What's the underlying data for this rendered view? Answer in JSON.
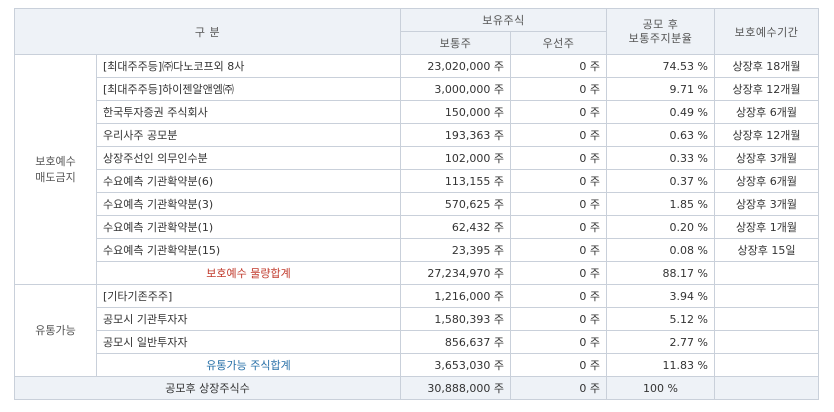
{
  "header": {
    "gubun": "구   분",
    "holdings": "보유주식",
    "common": "보통주",
    "preferred": "우선주",
    "ratio": "공모 후\n보통주지분율",
    "period": "보호예수기간"
  },
  "lockup_group": {
    "label": "보호예수\n매도금지",
    "rows": [
      {
        "name": "[최대주주등]㈜다노코프외 8사",
        "common": "23,020,000 주",
        "preferred": "0 주",
        "ratio": "74.53 %",
        "period": "상장후 18개월"
      },
      {
        "name": "[최대주주등]하이젠알앤엠㈜",
        "common": "3,000,000 주",
        "preferred": "0 주",
        "ratio": "9.71 %",
        "period": "상장후 12개월"
      },
      {
        "name": "한국투자증권 주식회사",
        "common": "150,000 주",
        "preferred": "0 주",
        "ratio": "0.49 %",
        "period": "상장후 6개월"
      },
      {
        "name": "우리사주 공모분",
        "common": "193,363 주",
        "preferred": "0 주",
        "ratio": "0.63 %",
        "period": "상장후 12개월"
      },
      {
        "name": "상장주선인 의무인수분",
        "common": "102,000 주",
        "preferred": "0 주",
        "ratio": "0.33 %",
        "period": "상장후 3개월"
      },
      {
        "name": "수요예측 기관확약분(6)",
        "common": "113,155 주",
        "preferred": "0 주",
        "ratio": "0.37 %",
        "period": "상장후 6개월"
      },
      {
        "name": "수요예측 기관확약분(3)",
        "common": "570,625 주",
        "preferred": "0 주",
        "ratio": "1.85 %",
        "period": "상장후 3개월"
      },
      {
        "name": "수요예측 기관확약분(1)",
        "common": "62,432 주",
        "preferred": "0 주",
        "ratio": "0.20 %",
        "period": "상장후 1개월"
      },
      {
        "name": "수요예측 기관확약분(15)",
        "common": "23,395 주",
        "preferred": "0 주",
        "ratio": "0.08 %",
        "period": "상장후 15일"
      }
    ],
    "subtotal": {
      "label": "보호예수 물량합계",
      "common": "27,234,970 주",
      "preferred": "0 주",
      "ratio": "88.17 %",
      "period": ""
    }
  },
  "tradable_group": {
    "label": "유통가능",
    "rows": [
      {
        "name": "[기타기존주주]",
        "common": "1,216,000 주",
        "preferred": "0 주",
        "ratio": "3.94 %",
        "period": ""
      },
      {
        "name": "공모시 기관투자자",
        "common": "1,580,393 주",
        "preferred": "0 주",
        "ratio": "5.12 %",
        "period": ""
      },
      {
        "name": "공모시 일반투자자",
        "common": "856,637 주",
        "preferred": "0 주",
        "ratio": "2.77 %",
        "period": ""
      }
    ],
    "subtotal": {
      "label": "유통가능 주식합계",
      "common": "3,653,030 주",
      "preferred": "0 주",
      "ratio": "11.83 %",
      "period": ""
    }
  },
  "total": {
    "label": "공모후 상장주식수",
    "common": "30,888,000 주",
    "preferred": "0 주",
    "ratio": "100 %",
    "period": ""
  }
}
